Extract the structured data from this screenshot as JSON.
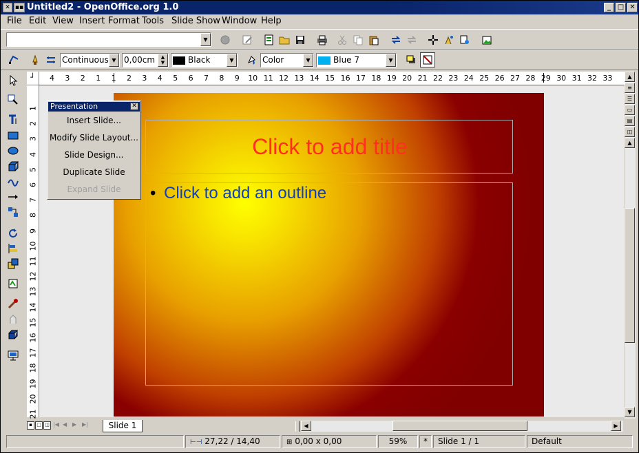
{
  "window": {
    "title": "Untitled2 - OpenOffice.org 1.0"
  },
  "menu": [
    "File",
    "Edit",
    "View",
    "Insert",
    "Format",
    "Tools",
    "Slide Show",
    "Window",
    "Help"
  ],
  "function_bar": {
    "url_value": ""
  },
  "object_bar": {
    "line_style": "Continuous",
    "line_width": "0,00cm",
    "line_color": "Black",
    "fill_type": "Color",
    "fill_color": "Blue 7",
    "line_color_hex": "#000000",
    "fill_color_hex": "#00b0f0"
  },
  "ruler_h": [
    "4",
    "3",
    "2",
    "1",
    "1",
    "2",
    "3",
    "4",
    "5",
    "6",
    "7",
    "8",
    "9",
    "10",
    "11",
    "12",
    "13",
    "14",
    "15",
    "16",
    "17",
    "18",
    "19",
    "20",
    "21",
    "22",
    "23",
    "24",
    "25",
    "26",
    "27",
    "28",
    "29",
    "30",
    "31",
    "32",
    "33"
  ],
  "ruler_v": [
    "1",
    "2",
    "3",
    "4",
    "5",
    "6",
    "7",
    "8",
    "9",
    "10",
    "11",
    "12",
    "13",
    "14",
    "15",
    "16",
    "17",
    "18",
    "19",
    "20",
    "21"
  ],
  "slide": {
    "title_placeholder": "Click to add title",
    "outline_placeholder": "Click to add an outline",
    "bullet": "•",
    "title_color": "#ff3020",
    "outline_color": "#1040c0"
  },
  "presentation_box": {
    "title": "Presentation",
    "items": [
      "Insert Slide...",
      "Modify Slide Layout...",
      "Slide Design...",
      "Duplicate Slide",
      "Expand Slide"
    ]
  },
  "tabs": {
    "active": "Slide 1"
  },
  "status": {
    "position": "27,22 / 14,40",
    "size": "0,00 x 0,00",
    "zoom": "59%",
    "mode": "*",
    "page": "Slide 1 / 1",
    "layout": "Default"
  }
}
